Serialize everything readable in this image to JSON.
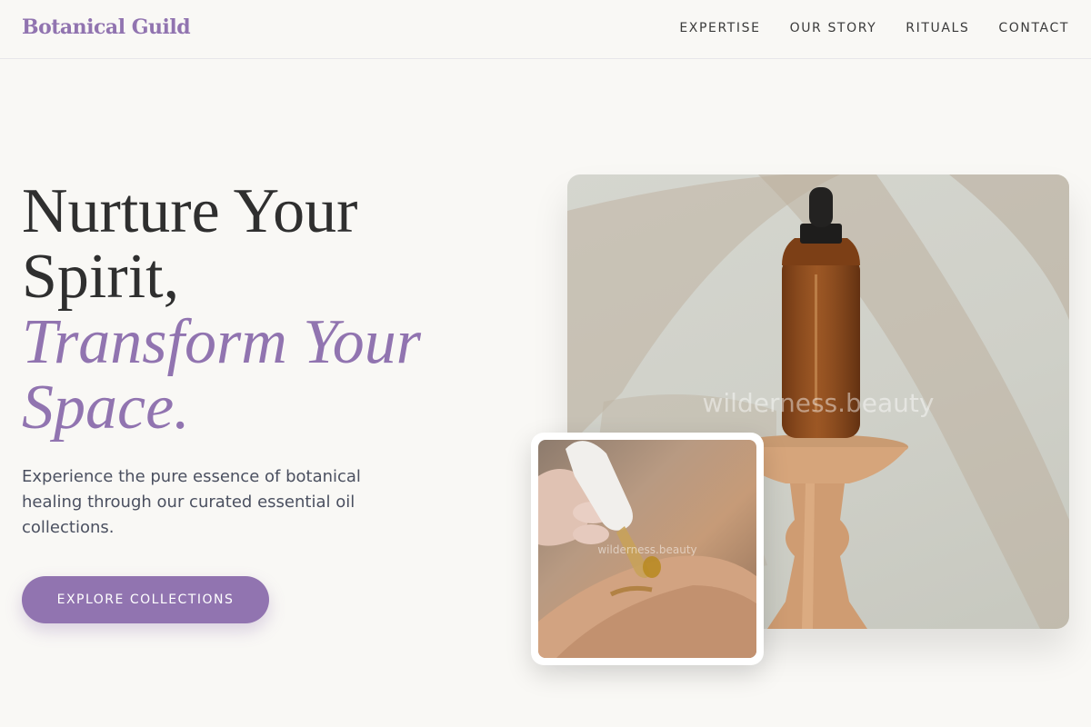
{
  "brand": {
    "name": "Botanical Guild"
  },
  "nav": {
    "items": [
      {
        "label": "EXPERTISE"
      },
      {
        "label": "OUR STORY"
      },
      {
        "label": "RITUALS"
      },
      {
        "label": "CONTACT"
      }
    ]
  },
  "hero": {
    "headline_line1": "Nurture Your",
    "headline_line2": "Spirit,",
    "headline_accent_line1": "Transform Your",
    "headline_accent_line2": "Space.",
    "subtitle": "Experience the pure essence of botanical healing through our curated essential oil collections.",
    "cta_label": "EXPLORE COLLECTIONS"
  },
  "images": {
    "main_watermark": "wilderness.beauty",
    "small_watermark": "wilderness.beauty"
  },
  "colors": {
    "accent": "#9174b0",
    "background": "#f9f8f5",
    "text_dark": "#2f2f2f"
  }
}
